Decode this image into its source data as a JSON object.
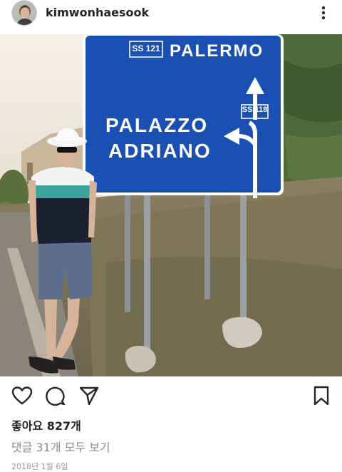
{
  "post": {
    "username": "kimwonhaesook",
    "likes": "좋아요 827개",
    "comments_link": "댓글 31개 모두 보기",
    "date": "2018년 1월 6일"
  },
  "sign": {
    "route_top": "SS 121",
    "destination_top": "PALERMO",
    "route_right": "SS 118",
    "destination_line1": "PALAZZO",
    "destination_line2": "ADRIANO"
  },
  "icons": {
    "avatar": "profile-avatar",
    "more": "more-vertical-icon",
    "like": "heart-icon",
    "comment": "comment-icon",
    "share": "paper-plane-icon",
    "save": "bookmark-icon"
  },
  "colors": {
    "sign_blue": "#1a4fb4",
    "text_primary": "#262626",
    "text_secondary": "#8e8e8e"
  }
}
